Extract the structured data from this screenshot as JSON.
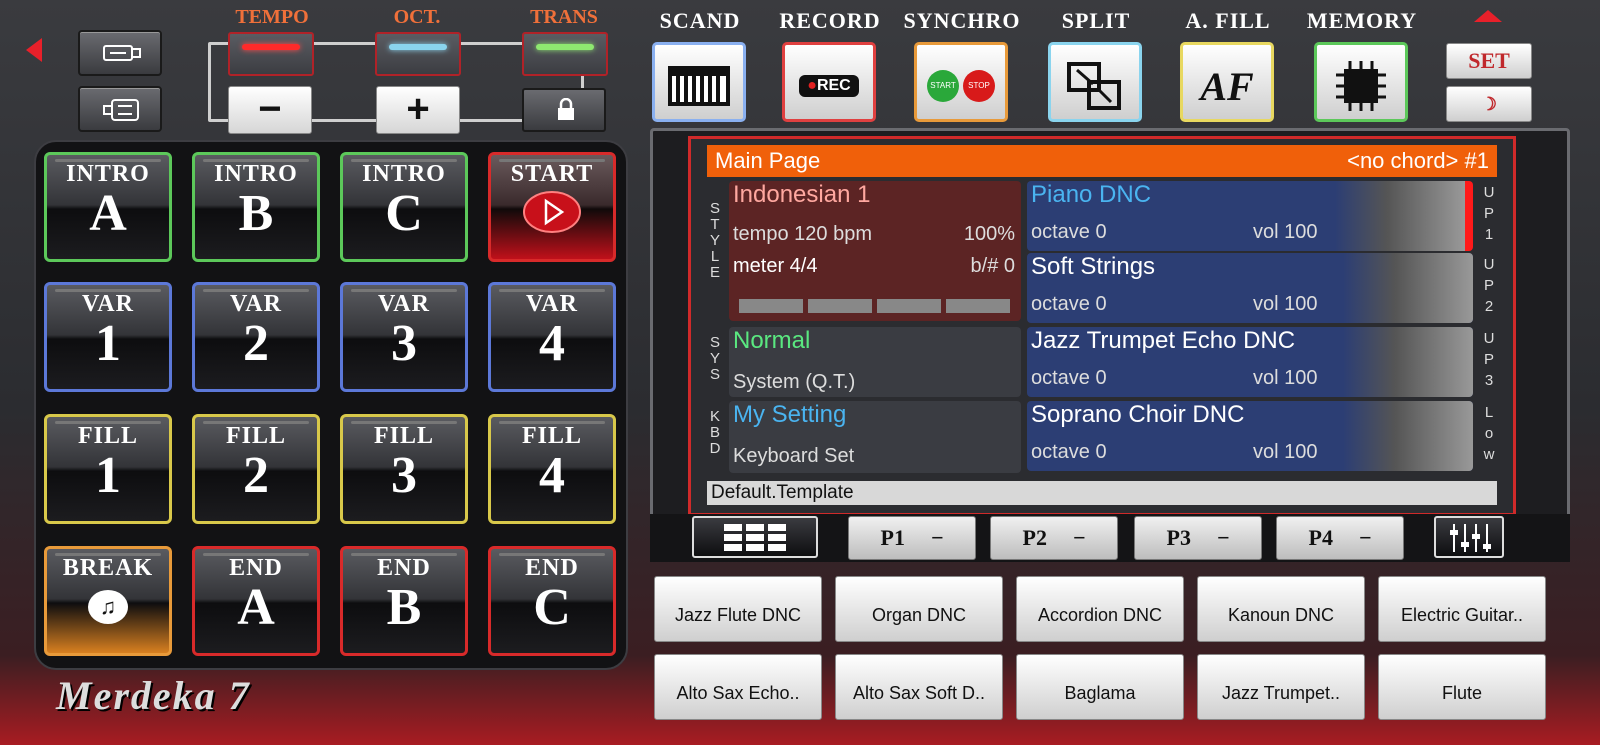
{
  "controls": {
    "tempo_label": "TEMPO",
    "oct_label": "OCT.",
    "trans_label": "TRANS",
    "minus": "−",
    "plus": "+"
  },
  "function_buttons": [
    {
      "label": "SCAND",
      "icon": "keyboard-icon"
    },
    {
      "label": "RECORD",
      "icon": "rec-icon",
      "text": "REC"
    },
    {
      "label": "SYNCHRO",
      "icon": "start-stop-icon",
      "start": "START",
      "stop": "STOP"
    },
    {
      "label": "SPLIT",
      "icon": "split-icon"
    },
    {
      "label": "A. FILL",
      "icon": "af-icon",
      "text": "AF"
    },
    {
      "label": "MEMORY",
      "icon": "chip-icon"
    }
  ],
  "set_label": "SET",
  "pads": [
    {
      "top": "INTRO",
      "big": "A"
    },
    {
      "top": "INTRO",
      "big": "B"
    },
    {
      "top": "INTRO",
      "big": "C"
    },
    {
      "top": "START",
      "big": ""
    },
    {
      "top": "VAR",
      "big": "1"
    },
    {
      "top": "VAR",
      "big": "2"
    },
    {
      "top": "VAR",
      "big": "3"
    },
    {
      "top": "VAR",
      "big": "4"
    },
    {
      "top": "FILL",
      "big": "1"
    },
    {
      "top": "FILL",
      "big": "2"
    },
    {
      "top": "FILL",
      "big": "3"
    },
    {
      "top": "FILL",
      "big": "4"
    },
    {
      "top": "BREAK",
      "big": ""
    },
    {
      "top": "END",
      "big": "A"
    },
    {
      "top": "END",
      "big": "B"
    },
    {
      "top": "END",
      "big": "C"
    }
  ],
  "logo": "Merdeka 7",
  "screen": {
    "title": "Main Page",
    "chord": "<no chord> #1",
    "style": {
      "side": [
        "S",
        "T",
        "Y",
        "L",
        "E"
      ],
      "name": "Indonesian 1",
      "tempo": "tempo 120 bpm",
      "percent": "100%",
      "meter": "meter 4/4",
      "bsharp": "b/#  0"
    },
    "sys": {
      "side": [
        "S",
        "Y",
        "S"
      ],
      "name": "Normal",
      "sub": "System (Q.T.)"
    },
    "kbd": {
      "side": [
        "K",
        "B",
        "D"
      ],
      "name": "My Setting",
      "sub": "Keyboard Set"
    },
    "voices": [
      {
        "name": "Piano DNC",
        "octave": "octave  0",
        "vol": "vol 100",
        "side": [
          "U",
          "P",
          "1"
        ]
      },
      {
        "name": "Soft Strings",
        "octave": "octave  0",
        "vol": "vol 100",
        "side": [
          "U",
          "P",
          "2"
        ]
      },
      {
        "name": "Jazz Trumpet Echo DNC",
        "octave": "octave  0",
        "vol": "vol 100",
        "side": [
          "U",
          "P",
          "3"
        ]
      },
      {
        "name": "Soprano Choir DNC",
        "octave": "octave  0",
        "vol": "vol 100",
        "side": [
          "L",
          "o",
          "w"
        ]
      }
    ],
    "footer": "Default.Template"
  },
  "pages": [
    {
      "label": "P1",
      "val": "−"
    },
    {
      "label": "P2",
      "val": "−"
    },
    {
      "label": "P3",
      "val": "−"
    },
    {
      "label": "P4",
      "val": "−"
    }
  ],
  "voice_buttons": [
    "Jazz Flute DNC",
    "Organ DNC",
    "Accordion DNC",
    "Kanoun DNC",
    "Electric Guitar..",
    "Alto Sax Echo..",
    "Alto Sax Soft D..",
    "Baglama",
    "Jazz Trumpet..",
    "Flute"
  ],
  "colors": {
    "accent_red": "#d82a2a",
    "orange": "#f0600a",
    "style_bg": "#5c2424",
    "voice_bg": "#2c3e74"
  }
}
